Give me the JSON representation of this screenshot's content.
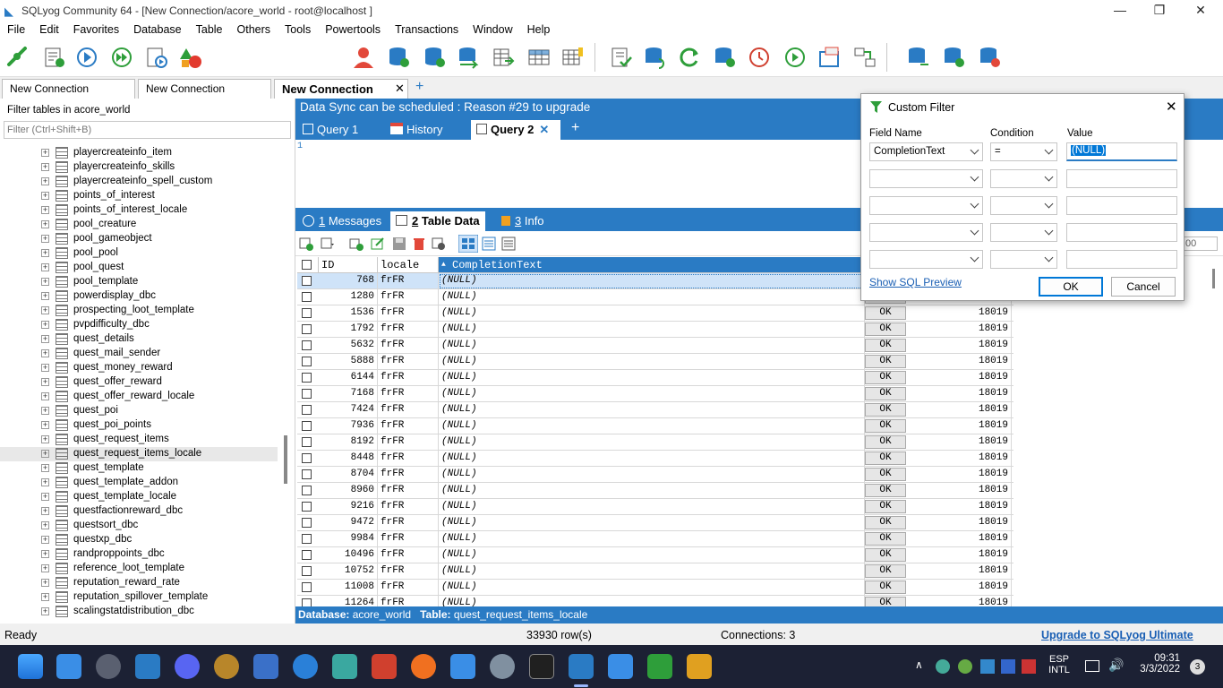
{
  "app": {
    "title": "SQLyog Community 64 - [New Connection/acore_world - root@localhost ]"
  },
  "menu": [
    "File",
    "Edit",
    "Favorites",
    "Database",
    "Table",
    "Others",
    "Tools",
    "Powertools",
    "Transactions",
    "Window",
    "Help"
  ],
  "toolbar": {
    "database_select": "acore_world"
  },
  "connection_tabs": [
    "New Connection",
    "New Connection",
    "New Connection"
  ],
  "left": {
    "filter_label": "Filter tables in acore_world",
    "filter_placeholder": "Filter (Ctrl+Shift+B)",
    "tables": [
      "playercreateinfo_item",
      "playercreateinfo_skills",
      "playercreateinfo_spell_custom",
      "points_of_interest",
      "points_of_interest_locale",
      "pool_creature",
      "pool_gameobject",
      "pool_pool",
      "pool_quest",
      "pool_template",
      "powerdisplay_dbc",
      "prospecting_loot_template",
      "pvpdifficulty_dbc",
      "quest_details",
      "quest_mail_sender",
      "quest_money_reward",
      "quest_offer_reward",
      "quest_offer_reward_locale",
      "quest_poi",
      "quest_poi_points",
      "quest_request_items",
      "quest_request_items_locale",
      "quest_template",
      "quest_template_addon",
      "quest_template_locale",
      "questfactionreward_dbc",
      "questsort_dbc",
      "questxp_dbc",
      "randproppoints_dbc",
      "reference_loot_template",
      "reputation_reward_rate",
      "reputation_spillover_template",
      "scalingstatdistribution_dbc"
    ],
    "selected_index": 21
  },
  "notice": "Data Sync can be scheduled : Reason #29 to upgrade",
  "query_tabs": [
    {
      "label": "Query 1"
    },
    {
      "label": "History"
    },
    {
      "label": "Query 2"
    }
  ],
  "editor": {
    "line_number": "1"
  },
  "result_tabs": [
    {
      "num": "1",
      "label": " Messages"
    },
    {
      "num": "2",
      "label": " Table Data"
    },
    {
      "num": "3",
      "label": " Info"
    }
  ],
  "grid": {
    "columns": [
      "ID",
      "locale",
      "CompletionText"
    ],
    "partial_value": "00",
    "rows": [
      {
        "id": "768",
        "locale": "frFR",
        "text": "(NULL)",
        "status": "OK",
        "build": "18019"
      },
      {
        "id": "1280",
        "locale": "frFR",
        "text": "(NULL)",
        "status": "OK",
        "build": "18019"
      },
      {
        "id": "1536",
        "locale": "frFR",
        "text": "(NULL)",
        "status": "OK",
        "build": "18019"
      },
      {
        "id": "1792",
        "locale": "frFR",
        "text": "(NULL)",
        "status": "OK",
        "build": "18019"
      },
      {
        "id": "5632",
        "locale": "frFR",
        "text": "(NULL)",
        "status": "OK",
        "build": "18019"
      },
      {
        "id": "5888",
        "locale": "frFR",
        "text": "(NULL)",
        "status": "OK",
        "build": "18019"
      },
      {
        "id": "6144",
        "locale": "frFR",
        "text": "(NULL)",
        "status": "OK",
        "build": "18019"
      },
      {
        "id": "7168",
        "locale": "frFR",
        "text": "(NULL)",
        "status": "OK",
        "build": "18019"
      },
      {
        "id": "7424",
        "locale": "frFR",
        "text": "(NULL)",
        "status": "OK",
        "build": "18019"
      },
      {
        "id": "7936",
        "locale": "frFR",
        "text": "(NULL)",
        "status": "OK",
        "build": "18019"
      },
      {
        "id": "8192",
        "locale": "frFR",
        "text": "(NULL)",
        "status": "OK",
        "build": "18019"
      },
      {
        "id": "8448",
        "locale": "frFR",
        "text": "(NULL)",
        "status": "OK",
        "build": "18019"
      },
      {
        "id": "8704",
        "locale": "frFR",
        "text": "(NULL)",
        "status": "OK",
        "build": "18019"
      },
      {
        "id": "8960",
        "locale": "frFR",
        "text": "(NULL)",
        "status": "OK",
        "build": "18019"
      },
      {
        "id": "9216",
        "locale": "frFR",
        "text": "(NULL)",
        "status": "OK",
        "build": "18019"
      },
      {
        "id": "9472",
        "locale": "frFR",
        "text": "(NULL)",
        "status": "OK",
        "build": "18019"
      },
      {
        "id": "9984",
        "locale": "frFR",
        "text": "(NULL)",
        "status": "OK",
        "build": "18019"
      },
      {
        "id": "10496",
        "locale": "frFR",
        "text": "(NULL)",
        "status": "OK",
        "build": "18019"
      },
      {
        "id": "10752",
        "locale": "frFR",
        "text": "(NULL)",
        "status": "OK",
        "build": "18019"
      },
      {
        "id": "11008",
        "locale": "frFR",
        "text": "(NULL)",
        "status": "OK",
        "build": "18019"
      },
      {
        "id": "11264",
        "locale": "frFR",
        "text": "(NULL)",
        "status": "OK",
        "build": "18019"
      }
    ]
  },
  "status_db": {
    "db_label": "Database:",
    "db": "acore_world",
    "table_label": "Table:",
    "table": "quest_request_items_locale"
  },
  "statusbar": {
    "ready": "Ready",
    "rows": "33930 row(s)",
    "connections": "Connections: 3",
    "upgrade": "Upgrade to SQLyog Ultimate"
  },
  "dialog": {
    "title": "Custom Filter",
    "field_name_label": "Field Name",
    "condition_label": "Condition",
    "value_label": "Value",
    "field_name": "CompletionText",
    "condition": "=",
    "value": "(NULL)",
    "show_sql": "Show SQL Preview",
    "ok": "OK",
    "cancel": "Cancel"
  },
  "taskbar": {
    "lang1": "ESP",
    "lang2": "INTL",
    "time": "09:31",
    "date": "3/3/2022",
    "badge": "3"
  },
  "colors": {
    "accent": "#2a7bc4",
    "selection": "#cfe3f8",
    "taskbar": "#1c2134"
  }
}
